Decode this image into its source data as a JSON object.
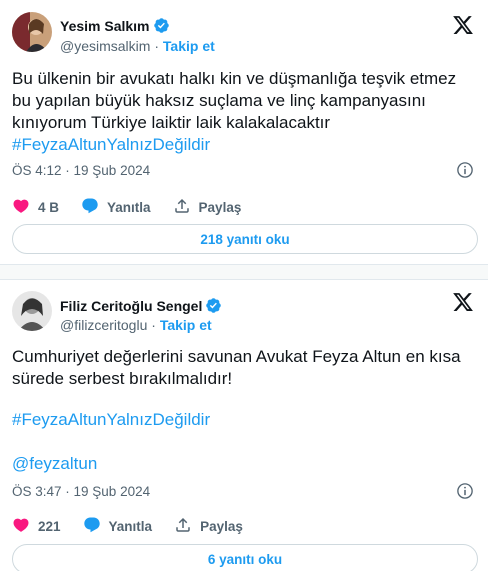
{
  "tweets": [
    {
      "author": "Yesim Salkım",
      "handle": "@yesimsalkim",
      "separator": "·",
      "follow": "Takip et",
      "text": "Bu ülkenin bir avukatı halkı kin ve düşmanlığa teşvik etmez bu yapılan büyük haksız suçlama ve linç kampanyasını kınıyorum Türkiye laiktir laik kalakalacaktır",
      "hashtag": "#FeyzaAltunYalnızDeğildir",
      "timestamp": "ÖS 4:12 · 19 Şub 2024",
      "likes": "4 B",
      "reply_label": "Yanıtla",
      "share_label": "Paylaş",
      "read_replies": "218 yanıtı oku"
    },
    {
      "author": "Filiz Ceritoğlu Sengel",
      "handle": "@filizceritoglu",
      "separator": "·",
      "follow": "Takip et",
      "text": "Cumhuriyet değerlerini savunan Avukat Feyza Altun en kısa sürede serbest bırakılmalıdır!",
      "hashtag": "#FeyzaAltunYalnızDeğildir",
      "mention": "@feyzaltun",
      "timestamp": "ÖS 3:47 · 19 Şub 2024",
      "likes": "221",
      "reply_label": "Yanıtla",
      "share_label": "Paylaş",
      "read_replies": "6 yanıtı oku"
    }
  ],
  "colors": {
    "accent": "#1d9bf0",
    "like": "#f91880",
    "muted": "#536471",
    "text": "#0f1419"
  },
  "icons": [
    "verified-badge-icon",
    "x-logo-icon",
    "info-icon",
    "heart-icon",
    "reply-bubble-icon",
    "share-icon"
  ]
}
